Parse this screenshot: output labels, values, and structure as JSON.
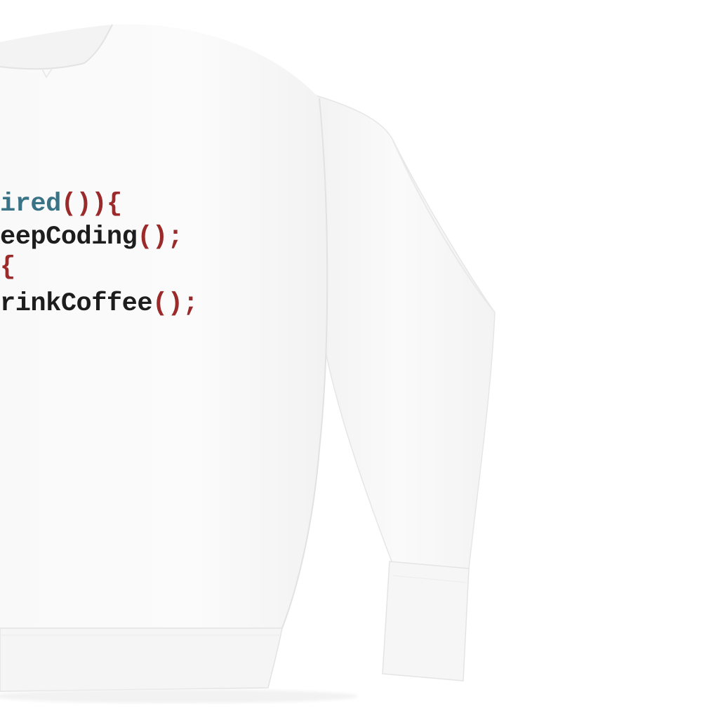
{
  "image": {
    "subject": "white crewneck sweatshirt with code print",
    "background_color": "#ffffff",
    "garment_color": "#ffffff"
  },
  "print": {
    "colors": {
      "teal": "#3a7386",
      "red": "#9b2a2a",
      "black": "#1d1d1d"
    },
    "lines": [
      {
        "segments": [
          {
            "text": "ired",
            "color": "teal"
          },
          {
            "text": "()){",
            "color": "red"
          }
        ]
      },
      {
        "segments": [
          {
            "text": "eepCoding",
            "color": "black"
          },
          {
            "text": "();",
            "color": "red"
          }
        ]
      },
      {
        "segments": [
          {
            "text": "{",
            "color": "red"
          }
        ]
      },
      {
        "segments": [
          {
            "text": "rinkCoffee",
            "color": "black"
          },
          {
            "text": "();",
            "color": "red"
          }
        ]
      }
    ]
  }
}
